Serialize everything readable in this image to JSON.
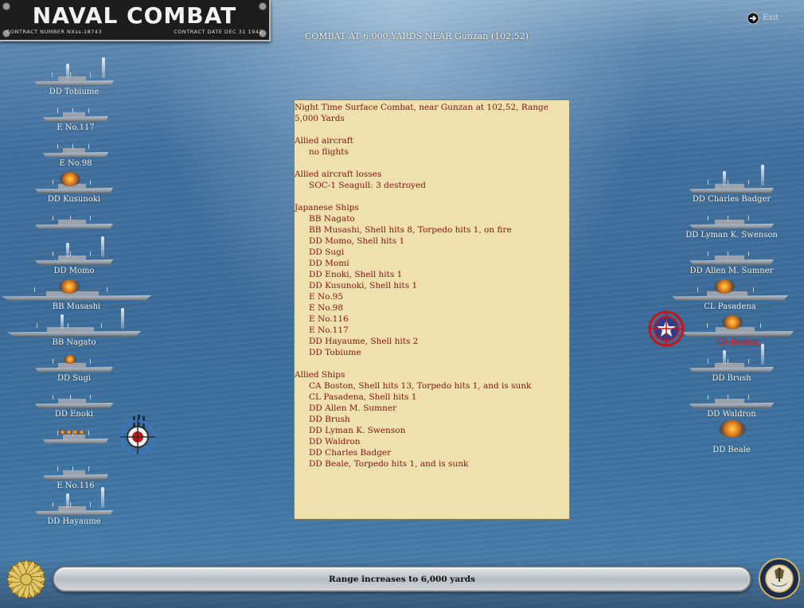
{
  "title": {
    "main": "NAVAL COMBAT",
    "contract_number": "CONTRACT NUMBER  NXss-18743",
    "contract_date": "CONTRACT DATE  DEC 31 1942"
  },
  "combat_header": "COMBAT AT 6,000 YARDS NEAR Gunzan (102,52)",
  "exit_label": "Exit",
  "report": [
    {
      "t": "Night Time Surface Combat, near Gunzan at 102,52, Range 5,000 Yards",
      "k": "title"
    },
    {
      "t": "",
      "k": "gap"
    },
    {
      "t": "Allied aircraft",
      "k": "title"
    },
    {
      "t": "no flights",
      "k": "item"
    },
    {
      "t": "",
      "k": "gap"
    },
    {
      "t": "Allied aircraft losses",
      "k": "title"
    },
    {
      "t": "SOC-1 Seagull: 3 destroyed",
      "k": "item"
    },
    {
      "t": "",
      "k": "gap"
    },
    {
      "t": "Japanese Ships",
      "k": "title"
    },
    {
      "t": "BB Nagato",
      "k": "item"
    },
    {
      "t": "BB Musashi, Shell hits 8, Torpedo hits 1,  on fire",
      "k": "item"
    },
    {
      "t": "DD Momo, Shell hits 1",
      "k": "item"
    },
    {
      "t": "DD Sugi",
      "k": "item"
    },
    {
      "t": "DD Momi",
      "k": "item"
    },
    {
      "t": "DD Enoki, Shell hits 1",
      "k": "item"
    },
    {
      "t": "DD Kusunoki, Shell hits 1",
      "k": "item"
    },
    {
      "t": "E No.95",
      "k": "item"
    },
    {
      "t": "E No.98",
      "k": "item"
    },
    {
      "t": "E No.116",
      "k": "item"
    },
    {
      "t": "E No.117",
      "k": "item"
    },
    {
      "t": "DD Hayaume, Shell hits 2",
      "k": "item"
    },
    {
      "t": "DD Tobiume",
      "k": "item"
    },
    {
      "t": "",
      "k": "gap"
    },
    {
      "t": "Allied Ships",
      "k": "title"
    },
    {
      "t": "CA Boston, Shell hits 13, Torpedo hits 1, and is sunk",
      "k": "item"
    },
    {
      "t": "CL Pasadena, Shell hits 1",
      "k": "item"
    },
    {
      "t": "DD Allen M. Sumner",
      "k": "item"
    },
    {
      "t": "DD Brush",
      "k": "item"
    },
    {
      "t": "DD Lyman K. Swenson",
      "k": "item"
    },
    {
      "t": "DD Waldron",
      "k": "item"
    },
    {
      "t": "DD Charles Badger",
      "k": "item"
    },
    {
      "t": "DD Beale, Torpedo hits 1, and is sunk",
      "k": "item"
    }
  ],
  "japanese_ships": [
    {
      "name": "DD Tobiume",
      "effect": "splash"
    },
    {
      "name": "E No.117",
      "effect": ""
    },
    {
      "name": "E No.98",
      "effect": ""
    },
    {
      "name": "DD Kusunoki",
      "effect": "fire"
    },
    {
      "name": "",
      "effect": ""
    },
    {
      "name": "DD Momo",
      "effect": "splash"
    },
    {
      "name": "BB Musashi",
      "effect": "fire"
    },
    {
      "name": "BB Nagato",
      "effect": "splash"
    },
    {
      "name": "DD Sugi",
      "effect": "smoke"
    },
    {
      "name": "DD Enoki",
      "effect": ""
    },
    {
      "name": "",
      "effect": "firing"
    },
    {
      "name": "E No.116",
      "effect": ""
    },
    {
      "name": "DD Hayaume",
      "effect": "splash"
    }
  ],
  "allied_ships": [
    {
      "name": "DD Charles Badger",
      "effect": "splash",
      "sunk": false
    },
    {
      "name": "DD Lyman K. Swenson",
      "effect": "",
      "sunk": false
    },
    {
      "name": "DD Allen M. Sumner",
      "effect": "",
      "sunk": false
    },
    {
      "name": "CL Pasadena",
      "effect": "fire",
      "sunk": false
    },
    {
      "name": "CA Boston",
      "effect": "fire",
      "sunk": true
    },
    {
      "name": "DD Brush",
      "effect": "splash",
      "sunk": false
    },
    {
      "name": "DD Waldron",
      "effect": "",
      "sunk": false
    },
    {
      "name": "DD Beale",
      "effect": "fire",
      "sunk": false
    }
  ],
  "status_message": "Range increases to 6,000 yards",
  "colors": {
    "report_bg": "#efe1ad",
    "report_text": "#8a1010",
    "sunk_label": "#ff2a2a",
    "label": "#f8f4e8"
  },
  "icons": {
    "exit": "exit-arrow-icon",
    "japan_emblem": "chrysanthemum-icon",
    "allied_emblem": "navy-seal-icon",
    "jp_target": "rising-sun-target-icon",
    "allied_target": "star-target-icon"
  }
}
